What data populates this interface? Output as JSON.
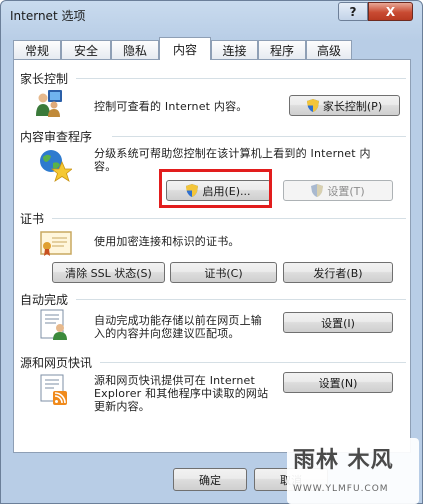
{
  "window": {
    "title": "Internet 选项",
    "help_label": "?",
    "close_label": "X"
  },
  "tabs": [
    {
      "label": "常规"
    },
    {
      "label": "安全"
    },
    {
      "label": "隐私"
    },
    {
      "label": "内容",
      "active": true
    },
    {
      "label": "连接"
    },
    {
      "label": "程序"
    },
    {
      "label": "高级"
    }
  ],
  "parental": {
    "heading": "家长控制",
    "description": "控制可查看的 Internet 内容。",
    "button": "家长控制(P)"
  },
  "advisor": {
    "heading": "内容审查程序",
    "description_1": "分级系统可帮助您控制在该计算机上看到的 Internet 内",
    "description_2": "容。",
    "enable_button": "启用(E)...",
    "settings_button": "设置(T)"
  },
  "certificates": {
    "heading": "证书",
    "description": "使用加密连接和标识的证书。",
    "clear_ssl_button": "清除 SSL 状态(S)",
    "certificates_button": "证书(C)",
    "publishers_button": "发行者(B)"
  },
  "autocomplete": {
    "heading": "自动完成",
    "description_1": "自动完成功能存储以前在网页上输",
    "description_2": "入的内容并向您建议匹配项。",
    "button": "设置(I)"
  },
  "feeds": {
    "heading": "源和网页快讯",
    "description_1": "源和网页快讯提供可在 Internet",
    "description_2": "Explorer 和其他程序中读取的网站",
    "description_3": "更新内容。",
    "button": "设置(N)"
  },
  "footer": {
    "ok_button": "确定",
    "cancel_button": "取消"
  },
  "watermark": {
    "main": "雨林 木风",
    "url": "WWW.YLMFU.COM"
  },
  "colors": {
    "highlight": "#e21d1d",
    "shield_blue": "#2f6fcf",
    "shield_yellow": "#f3c53a"
  }
}
